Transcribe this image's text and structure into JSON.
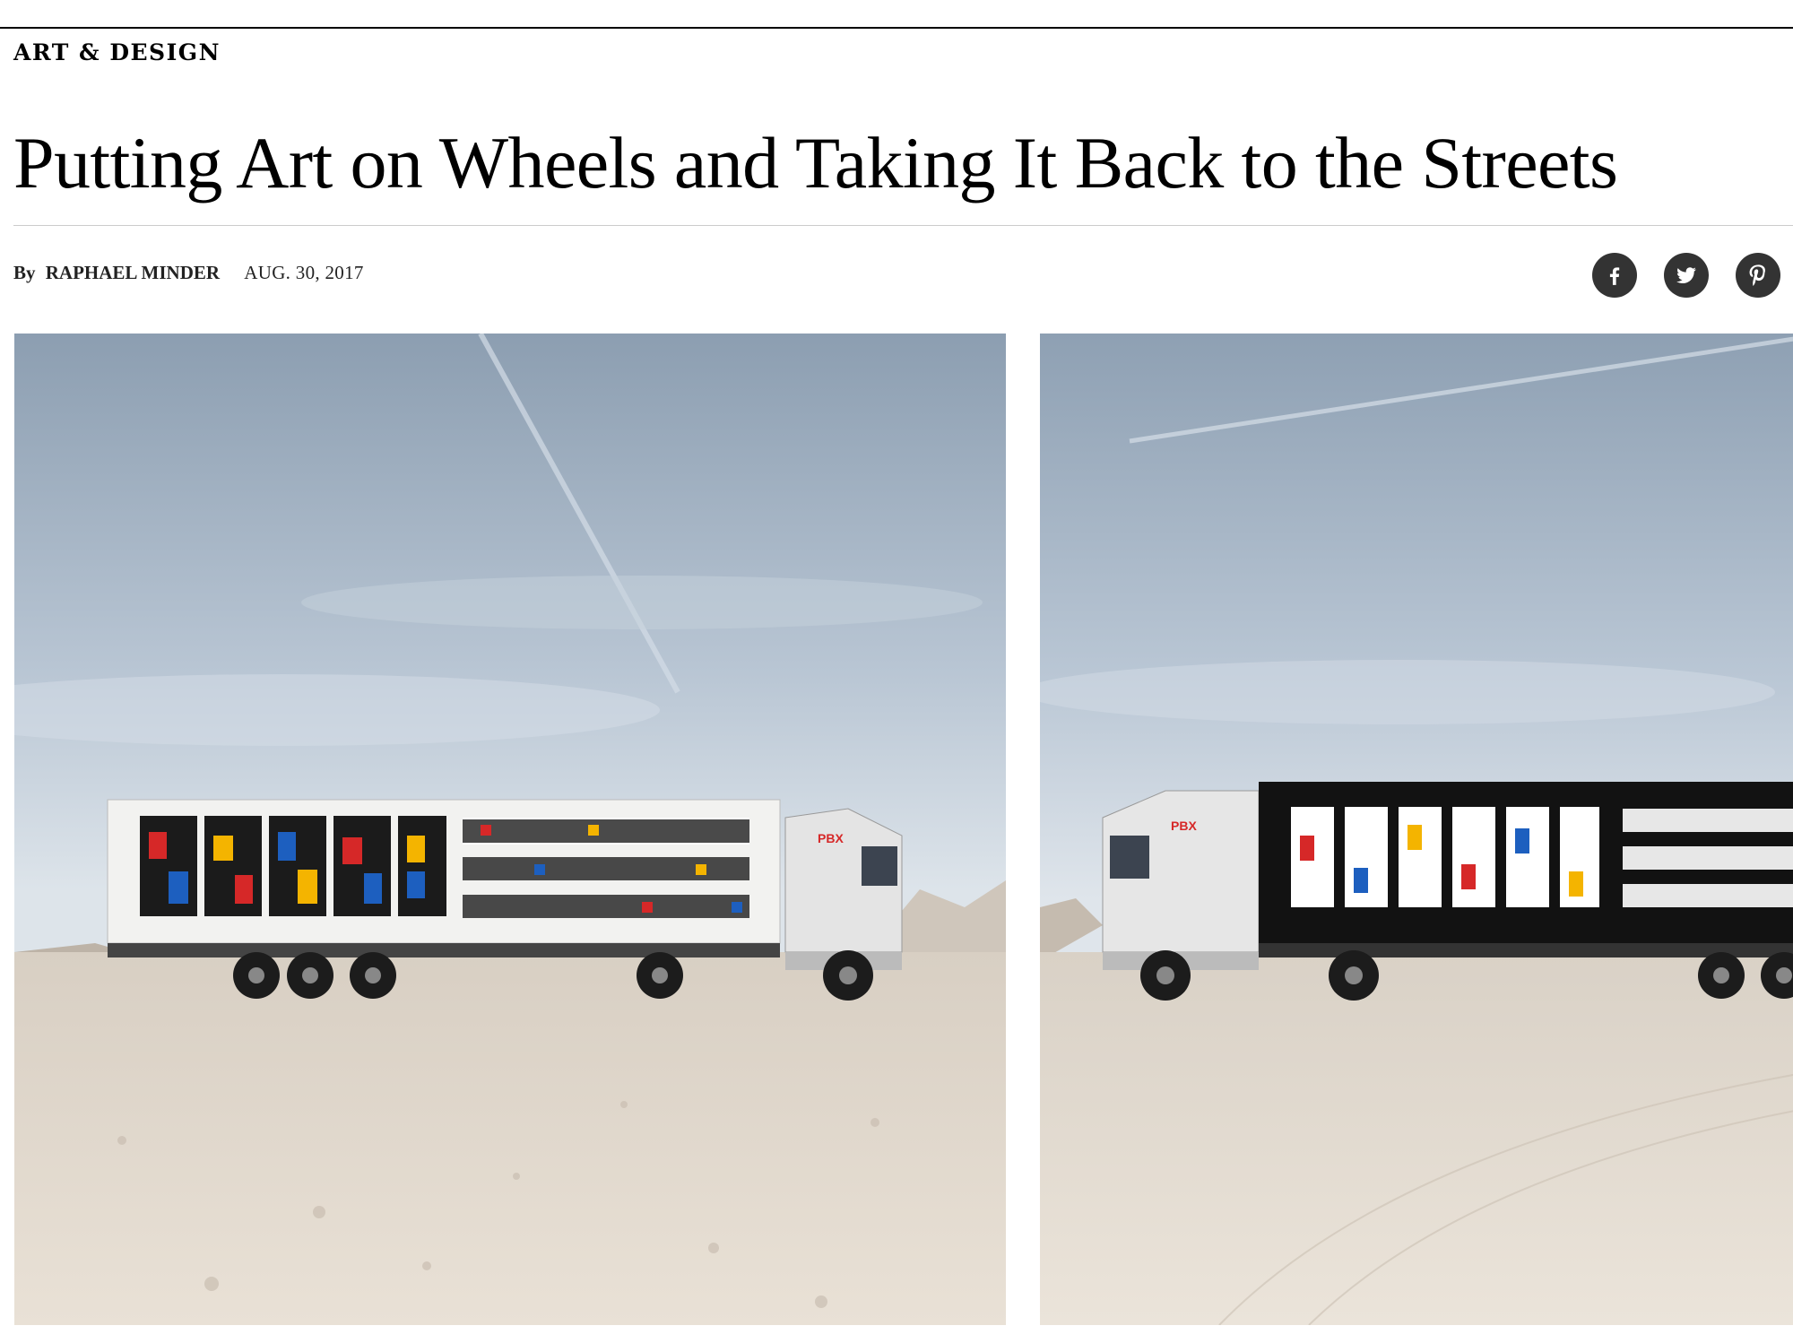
{
  "section": {
    "label": "ART & DESIGN"
  },
  "article": {
    "headline": "Putting Art on Wheels and Taking It Back to the Streets",
    "byline_prefix": "By",
    "author": "RAPHAEL MINDER",
    "date": "AUG. 30, 2017"
  },
  "share": [
    {
      "name": "facebook",
      "icon": "facebook-icon"
    },
    {
      "name": "twitter",
      "icon": "twitter-icon"
    },
    {
      "name": "pinterest",
      "icon": "pinterest-icon"
    }
  ],
  "photos": [
    {
      "name": "white-truck-photo",
      "cab_logo": "PBX"
    },
    {
      "name": "black-truck-photo",
      "cab_logo": "PBX"
    }
  ],
  "colors": {
    "text": "#111111",
    "share_button": "#333333",
    "rule": "#cccccc",
    "sky": "#a9b8c8",
    "ground": "#e6ddd2",
    "art_red": "#d62828",
    "art_blue": "#1d5fbf",
    "art_yellow": "#f4b400"
  }
}
